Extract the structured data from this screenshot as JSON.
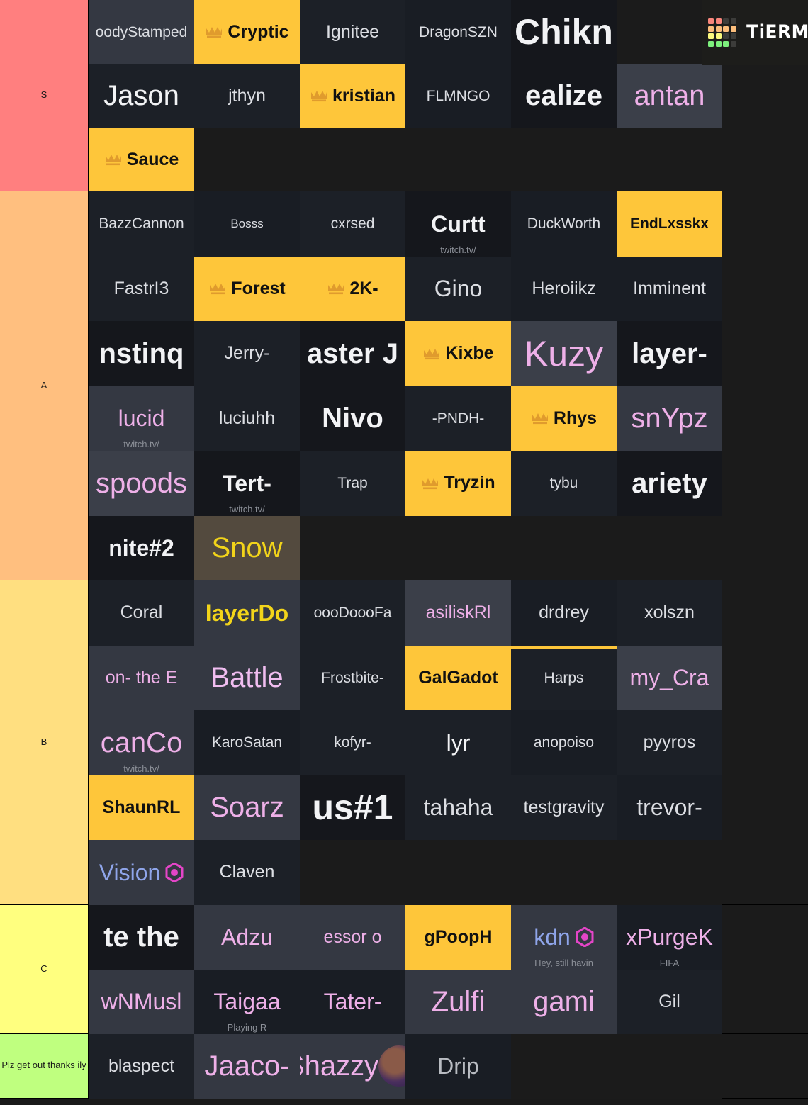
{
  "app": {
    "watermark_text": "TiERMAKER"
  },
  "watermark_grid": [
    [
      "#f9867c",
      "#f9867c",
      "#3c3c3a",
      "#3c3c3a"
    ],
    [
      "#fcbe7c",
      "#fcbe7c",
      "#fcbe7c",
      "#fcbe7c"
    ],
    [
      "#fbf97e",
      "#fbf97e",
      "#3c3c3a",
      "#3c3c3a"
    ],
    [
      "#7df07d",
      "#7df07d",
      "#7df07d",
      "#3c3c3a"
    ]
  ],
  "colors": {
    "tier_s": "#ff7f7f",
    "tier_a": "#ffbf7f",
    "tier_b": "#ffdf80",
    "tier_c": "#ffff7f",
    "tier_d": "#bfff7f",
    "highlight_yellow": "#fec63a",
    "crown_gold": "#e09b2d",
    "hex_pink": "#e545c8"
  },
  "tiers": [
    {
      "label": "S",
      "color": "#ff7f7f",
      "rows": 3,
      "cells": [
        {
          "text": "oodyStamped",
          "bg": "bg-grey2",
          "tx": "tx-wsoft",
          "fs": "fs-sm"
        },
        {
          "text": "Cryptic",
          "bg": "bg-yellow",
          "tx": "tx-black",
          "fs": "fs-md",
          "bold": true,
          "crown": true
        },
        {
          "text": "Ignitee",
          "bg": "bg-dark",
          "tx": "tx-wsoft",
          "fs": "fs-md"
        },
        {
          "text": "DragonSZN",
          "bg": "bg-dark2",
          "tx": "tx-wsoft",
          "fs": "fs-sm"
        },
        {
          "text": "Chikn",
          "bg": "bg-black",
          "tx": "tx-white",
          "fs": "fs-xxl",
          "bold": true
        },
        {
          "text": "",
          "bg": "bg-watermark"
        },
        {
          "text": "Jason",
          "bg": "bg-dark",
          "tx": "tx-white",
          "fs": "fs-xl"
        },
        {
          "text": "jthyn",
          "bg": "bg-dark",
          "tx": "tx-wsoft",
          "fs": "fs-md"
        },
        {
          "text": "kristian",
          "bg": "bg-yellow",
          "tx": "tx-black",
          "fs": "fs-md",
          "bold": true,
          "crown": true
        },
        {
          "text": "FLMNGO",
          "bg": "bg-dark2",
          "tx": "tx-wsoft",
          "fs": "fs-sm"
        },
        {
          "text": "ealize",
          "bg": "bg-black",
          "tx": "tx-white",
          "fs": "fs-xl",
          "bold": true
        },
        {
          "text": "antan",
          "bg": "bg-grey",
          "tx": "tx-pink",
          "fs": "fs-xl"
        },
        {
          "text": "Sauce",
          "bg": "bg-yellow",
          "tx": "tx-black",
          "fs": "fs-md",
          "bold": true,
          "crown": true
        },
        {
          "text": "",
          "bg": "bg-empty"
        },
        {
          "text": "",
          "bg": "bg-empty"
        },
        {
          "text": "",
          "bg": "bg-empty"
        },
        {
          "text": "",
          "bg": "bg-empty"
        },
        {
          "text": "",
          "bg": "bg-empty"
        }
      ]
    },
    {
      "label": "A",
      "color": "#ffbf7f",
      "rows": 6,
      "cells": [
        {
          "text": "BazzCannon",
          "bg": "bg-dark",
          "tx": "tx-wsoft",
          "fs": "fs-sm"
        },
        {
          "text": "Bosss",
          "bg": "bg-dark2",
          "tx": "tx-wsoft",
          "fs": "fs-xs"
        },
        {
          "text": "cxrsed",
          "bg": "bg-dark",
          "tx": "tx-wsoft",
          "fs": "fs-sm"
        },
        {
          "text": "Curtt",
          "bg": "bg-black",
          "tx": "tx-white",
          "fs": "fs-lg",
          "bold": true,
          "sub": "twitch.tv/"
        },
        {
          "text": "DuckWorth",
          "bg": "bg-dark2",
          "tx": "tx-wsoft",
          "fs": "fs-sm"
        },
        {
          "text": "EndLxsskx",
          "bg": "bg-yellow",
          "tx": "tx-black",
          "fs": "fs-sm",
          "bold": true
        },
        {
          "text": "FastrI3",
          "bg": "bg-dark",
          "tx": "tx-wsoft",
          "fs": "fs-md"
        },
        {
          "text": "Forest",
          "bg": "bg-yellow",
          "tx": "tx-black",
          "fs": "fs-md",
          "bold": true,
          "crown": true,
          "accent": true
        },
        {
          "text": "2K-",
          "bg": "bg-yellow",
          "tx": "tx-black",
          "fs": "fs-md",
          "bold": true,
          "crown": true
        },
        {
          "text": "Gino",
          "bg": "bg-dark",
          "tx": "tx-wsoft",
          "fs": "fs-lg"
        },
        {
          "text": "Heroiikz",
          "bg": "bg-dark2",
          "tx": "tx-wsoft",
          "fs": "fs-md"
        },
        {
          "text": "Imminent",
          "bg": "bg-dark2",
          "tx": "tx-wsoft",
          "fs": "fs-md"
        },
        {
          "text": "nstinq",
          "bg": "bg-black",
          "tx": "tx-white",
          "fs": "fs-xl",
          "bold": true
        },
        {
          "text": "Jerry-",
          "bg": "bg-dark",
          "tx": "tx-wsoft",
          "fs": "fs-md"
        },
        {
          "text": "aster J",
          "bg": "bg-black",
          "tx": "tx-white",
          "fs": "fs-xl",
          "bold": true
        },
        {
          "text": "Kixbe",
          "bg": "bg-yellow",
          "tx": "tx-black",
          "fs": "fs-md",
          "bold": true,
          "crown": true
        },
        {
          "text": "Kuzy",
          "bg": "bg-grey",
          "tx": "tx-pink",
          "fs": "fs-xxl"
        },
        {
          "text": "layer-",
          "bg": "bg-black",
          "tx": "tx-white",
          "fs": "fs-xl",
          "bold": true
        },
        {
          "text": "lucid",
          "bg": "bg-grey2",
          "tx": "tx-pink",
          "fs": "fs-lg",
          "sub": "twitch.tv/"
        },
        {
          "text": "luciuhh",
          "bg": "bg-dark",
          "tx": "tx-wsoft",
          "fs": "fs-md"
        },
        {
          "text": "Nivo",
          "bg": "bg-black",
          "tx": "tx-white",
          "fs": "fs-xl",
          "bold": true
        },
        {
          "text": "-PNDH-",
          "bg": "bg-dark",
          "tx": "tx-wsoft",
          "fs": "fs-sm"
        },
        {
          "text": "Rhys",
          "bg": "bg-yellow",
          "tx": "tx-black",
          "fs": "fs-md",
          "bold": true,
          "crown": true
        },
        {
          "text": "snYpz",
          "bg": "bg-grey2",
          "tx": "tx-pink",
          "fs": "fs-xl"
        },
        {
          "text": "spoods",
          "bg": "bg-grey",
          "tx": "tx-pink",
          "fs": "fs-xl"
        },
        {
          "text": "Tert-",
          "bg": "bg-black",
          "tx": "tx-white",
          "fs": "fs-lg",
          "bold": true,
          "sub": "twitch.tv/"
        },
        {
          "text": "Trap",
          "bg": "bg-dark",
          "tx": "tx-wsoft",
          "fs": "fs-sm"
        },
        {
          "text": "Tryzin",
          "bg": "bg-yellow",
          "tx": "tx-black",
          "fs": "fs-md",
          "bold": true,
          "crown": true
        },
        {
          "text": "tybu",
          "bg": "bg-dark",
          "tx": "tx-wsoft",
          "fs": "fs-sm"
        },
        {
          "text": "ariety",
          "bg": "bg-black",
          "tx": "tx-white",
          "fs": "fs-xl",
          "bold": true
        },
        {
          "text": "nite#2",
          "bg": "bg-black",
          "tx": "tx-white",
          "fs": "fs-lg",
          "bold": true
        },
        {
          "text": "Snow",
          "bg": "bg-brown",
          "tx": "tx-yellow",
          "fs": "fs-xl"
        },
        {
          "text": "",
          "bg": "bg-empty"
        },
        {
          "text": "",
          "bg": "bg-empty"
        },
        {
          "text": "",
          "bg": "bg-empty"
        },
        {
          "text": "",
          "bg": "bg-empty"
        }
      ]
    },
    {
      "label": "B",
      "color": "#ffdf80",
      "rows": 5,
      "cells": [
        {
          "text": "Coral",
          "bg": "bg-dark",
          "tx": "tx-wsoft",
          "fs": "fs-md"
        },
        {
          "text": "layerDo",
          "bg": "bg-grey2",
          "tx": "tx-yellow",
          "fs": "fs-lg",
          "bold": true
        },
        {
          "text": "oooDoooFa",
          "bg": "bg-dark",
          "tx": "tx-wsoft",
          "fs": "fs-sm"
        },
        {
          "text": "asiliskRl",
          "bg": "bg-grey",
          "tx": "tx-pink",
          "fs": "fs-md"
        },
        {
          "text": "drdrey",
          "bg": "bg-dark2",
          "tx": "tx-wsoft",
          "fs": "fs-md"
        },
        {
          "text": "xolszn",
          "bg": "bg-dark",
          "tx": "tx-wsoft",
          "fs": "fs-md"
        },
        {
          "text": "on- the E",
          "bg": "bg-grey2",
          "tx": "tx-pink",
          "fs": "fs-md"
        },
        {
          "text": "Battle",
          "bg": "bg-grey2",
          "tx": "tx-pink2",
          "fs": "fs-xl"
        },
        {
          "text": "Frostbite-",
          "bg": "bg-dark",
          "tx": "tx-wsoft",
          "fs": "fs-sm"
        },
        {
          "text": "GalGadot",
          "bg": "bg-yellow",
          "tx": "tx-black",
          "fs": "fs-md",
          "bold": true
        },
        {
          "text": "Harps",
          "bg": "bg-dark",
          "tx": "tx-wsoft",
          "fs": "fs-sm",
          "accent": true
        },
        {
          "text": "my_Cra",
          "bg": "bg-grey",
          "tx": "tx-pink",
          "fs": "fs-lg"
        },
        {
          "text": "canCo",
          "bg": "bg-grey2",
          "tx": "tx-pink",
          "fs": "fs-xl",
          "sub": "twitch.tv/"
        },
        {
          "text": "KaroSatan",
          "bg": "bg-dark2",
          "tx": "tx-wsoft",
          "fs": "fs-sm"
        },
        {
          "text": "kofyr-",
          "bg": "bg-dark",
          "tx": "tx-wsoft",
          "fs": "fs-sm"
        },
        {
          "text": "lyr",
          "bg": "bg-dark",
          "tx": "tx-white",
          "fs": "fs-lg"
        },
        {
          "text": "anopoiso",
          "bg": "bg-dark2",
          "tx": "tx-wsoft",
          "fs": "fs-sm"
        },
        {
          "text": "pyyros",
          "bg": "bg-dark",
          "tx": "tx-wsoft",
          "fs": "fs-md"
        },
        {
          "text": "ShaunRL",
          "bg": "bg-yellow",
          "tx": "tx-black",
          "fs": "fs-md",
          "bold": true
        },
        {
          "text": "Soarz",
          "bg": "bg-grey2",
          "tx": "tx-pink",
          "fs": "fs-xl"
        },
        {
          "text": "us#1",
          "bg": "bg-black",
          "tx": "tx-white",
          "fs": "fs-xxl",
          "bold": true
        },
        {
          "text": "tahaha",
          "bg": "bg-dark",
          "tx": "tx-wsoft",
          "fs": "fs-lg"
        },
        {
          "text": "testgravity",
          "bg": "bg-dark",
          "tx": "tx-wsoft",
          "fs": "fs-md"
        },
        {
          "text": "trevor-",
          "bg": "bg-dark2",
          "tx": "tx-wsoft",
          "fs": "fs-lg"
        },
        {
          "text": "Vision",
          "bg": "bg-grey2",
          "tx": "tx-blue",
          "fs": "fs-lg",
          "hex": true
        },
        {
          "text": "Claven",
          "bg": "bg-dark",
          "tx": "tx-wsoft",
          "fs": "fs-md"
        },
        {
          "text": "",
          "bg": "bg-empty"
        },
        {
          "text": "",
          "bg": "bg-empty"
        },
        {
          "text": "",
          "bg": "bg-empty"
        },
        {
          "text": "",
          "bg": "bg-empty"
        }
      ]
    },
    {
      "label": "C",
      "color": "#ffff7f",
      "rows": 2,
      "cells": [
        {
          "text": "te the",
          "bg": "bg-black",
          "tx": "tx-white",
          "fs": "fs-xl",
          "bold": true
        },
        {
          "text": "Adzu",
          "bg": "bg-grey2",
          "tx": "tx-pink",
          "fs": "fs-lg"
        },
        {
          "text": "essor o",
          "bg": "bg-grey2",
          "tx": "tx-pink",
          "fs": "fs-md"
        },
        {
          "text": "gPoopH",
          "bg": "bg-yellow",
          "tx": "tx-black",
          "fs": "fs-md",
          "bold": true
        },
        {
          "text": "kdn",
          "bg": "bg-grey2",
          "tx": "tx-blue",
          "fs": "fs-lg",
          "hex": true,
          "sub": "Hey, still havin"
        },
        {
          "text": "xPurgeK",
          "bg": "bg-dark2",
          "tx": "tx-pink",
          "fs": "fs-lg",
          "sub": "FIFA"
        },
        {
          "text": "wNMusl",
          "bg": "bg-grey2",
          "tx": "tx-pink",
          "fs": "fs-lg"
        },
        {
          "text": "Taigaa",
          "bg": "bg-dark2",
          "tx": "tx-pink",
          "fs": "fs-lg",
          "sub": "Playing R"
        },
        {
          "text": "Tater-",
          "bg": "bg-dark2",
          "tx": "tx-pink",
          "fs": "fs-lg"
        },
        {
          "text": "Zulfi",
          "bg": "bg-grey2",
          "tx": "tx-pink",
          "fs": "fs-xl"
        },
        {
          "text": "gami",
          "bg": "bg-grey2",
          "tx": "tx-pink",
          "fs": "fs-xl"
        },
        {
          "text": "Gil",
          "bg": "bg-dark",
          "tx": "tx-wsoft",
          "fs": "fs-md"
        }
      ]
    },
    {
      "label": "Plz get out thanks ily",
      "color": "#bfff7f",
      "rows": 1,
      "cells": [
        {
          "text": "blaspect",
          "bg": "bg-dark",
          "tx": "tx-wsoft",
          "fs": "fs-md"
        },
        {
          "text": "Jaaco-",
          "bg": "bg-grey2",
          "tx": "tx-pink",
          "fs": "fs-xl"
        },
        {
          "text": "Shazzy",
          "bg": "bg-grey2",
          "tx": "tx-pink",
          "fs": "fs-xl",
          "avatar": true
        },
        {
          "text": "Drip",
          "bg": "bg-dark2",
          "tx": "tx-grey",
          "fs": "fs-lg"
        },
        {
          "text": "",
          "bg": "bg-empty"
        },
        {
          "text": "",
          "bg": "bg-empty"
        }
      ]
    }
  ]
}
